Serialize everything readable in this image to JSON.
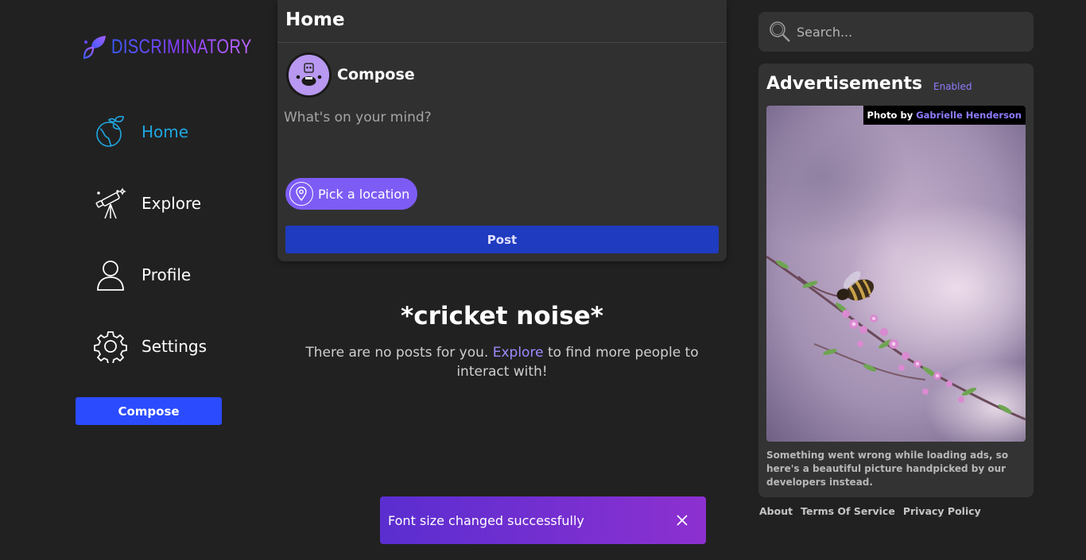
{
  "brand": {
    "name": "DISCRIMINATORY",
    "gradient": [
      "#3b5bff",
      "#c06bff"
    ]
  },
  "sidebar": {
    "items": [
      {
        "label": "Home",
        "icon": "globe-icon",
        "active": true
      },
      {
        "label": "Explore",
        "icon": "telescope-icon",
        "active": false
      },
      {
        "label": "Profile",
        "icon": "user-icon",
        "active": false
      },
      {
        "label": "Settings",
        "icon": "gear-icon",
        "active": false
      }
    ],
    "compose_label": "Compose",
    "active_color": "#1fa7e0"
  },
  "feed": {
    "title": "Home",
    "composer": {
      "heading": "Compose",
      "placeholder": "What's on your mind?",
      "location_label": "Pick a location",
      "post_label": "Post"
    },
    "empty": {
      "title": "*cricket noise*",
      "message_before": "There are no posts for you.",
      "link_label": "Explore",
      "message_after": "to find more people to interact with!"
    }
  },
  "search": {
    "placeholder": "Search..."
  },
  "ads": {
    "title": "Advertisements",
    "status": "Enabled",
    "photo_credit_prefix": "Photo by",
    "photo_author": "Gabrielle Henderson",
    "message": "Something went wrong while loading ads, so here's a beautiful picture handpicked by our developers instead."
  },
  "footer": {
    "links": [
      "About",
      "Terms Of Service",
      "Privacy Policy"
    ]
  },
  "toast": {
    "message": "Font size changed successfully",
    "close_icon": "close-icon"
  },
  "colors": {
    "background": "#212121",
    "card": "#303030",
    "accent": "#2b4bff",
    "link": "#9a8cff"
  }
}
